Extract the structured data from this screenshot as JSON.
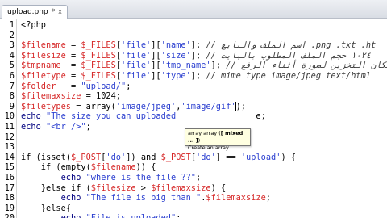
{
  "tab": {
    "title": "upload.php",
    "modified": "*",
    "close": "x"
  },
  "lines": [
    {
      "n": "1",
      "segments": [
        {
          "t": "<?php",
          "c": "plain"
        }
      ]
    },
    {
      "n": "2",
      "segments": []
    },
    {
      "n": "3",
      "segments": [
        {
          "t": "$filename",
          "c": "var"
        },
        {
          "t": " = ",
          "c": "plain"
        },
        {
          "t": "$_FILES",
          "c": "var"
        },
        {
          "t": "[",
          "c": "plain"
        },
        {
          "t": "'file'",
          "c": "str"
        },
        {
          "t": "][",
          "c": "plain"
        },
        {
          "t": "'name'",
          "c": "str"
        },
        {
          "t": "]; ",
          "c": "plain"
        },
        {
          "t": "// اسم الملف والتابع .png .txt .ht",
          "c": "cmt"
        }
      ]
    },
    {
      "n": "4",
      "segments": [
        {
          "t": "$filesize",
          "c": "var"
        },
        {
          "t": " = ",
          "c": "plain"
        },
        {
          "t": "$_FILES",
          "c": "var"
        },
        {
          "t": "[",
          "c": "plain"
        },
        {
          "t": "'file'",
          "c": "str"
        },
        {
          "t": "][",
          "c": "plain"
        },
        {
          "t": "'size'",
          "c": "str"
        },
        {
          "t": "]; ",
          "c": "plain"
        },
        {
          "t": "// ١٠٢٤ حجم الملف المطلوب بالبايت",
          "c": "cmt"
        }
      ]
    },
    {
      "n": "5",
      "segments": [
        {
          "t": "$tmpname",
          "c": "var"
        },
        {
          "t": "  = ",
          "c": "plain"
        },
        {
          "t": "$_FILES",
          "c": "var"
        },
        {
          "t": "[",
          "c": "plain"
        },
        {
          "t": "'file'",
          "c": "str"
        },
        {
          "t": "][",
          "c": "plain"
        },
        {
          "t": "'tmp_name'",
          "c": "str"
        },
        {
          "t": "]; ",
          "c": "plain"
        },
        {
          "t": "// مكان التخزين لصورة أثناء الرفع",
          "c": "cmt"
        }
      ]
    },
    {
      "n": "6",
      "segments": [
        {
          "t": "$filetype",
          "c": "var"
        },
        {
          "t": " = ",
          "c": "plain"
        },
        {
          "t": "$_FILES",
          "c": "var"
        },
        {
          "t": "[",
          "c": "plain"
        },
        {
          "t": "'file'",
          "c": "str"
        },
        {
          "t": "][",
          "c": "plain"
        },
        {
          "t": "'type'",
          "c": "str"
        },
        {
          "t": "]; ",
          "c": "plain"
        },
        {
          "t": "// mime type image/jpeg text/html",
          "c": "cmt"
        }
      ]
    },
    {
      "n": "7",
      "segments": [
        {
          "t": "$folder",
          "c": "var"
        },
        {
          "t": "   = ",
          "c": "plain"
        },
        {
          "t": "\"upload/\"",
          "c": "str"
        },
        {
          "t": ";",
          "c": "plain"
        }
      ]
    },
    {
      "n": "8",
      "segments": [
        {
          "t": "$filemaxsize",
          "c": "var"
        },
        {
          "t": " = 1024;",
          "c": "plain"
        }
      ]
    },
    {
      "n": "9",
      "segments": [
        {
          "t": "$filetypes",
          "c": "var"
        },
        {
          "t": " = array(",
          "c": "plain"
        },
        {
          "t": "'image/jpeg'",
          "c": "str"
        },
        {
          "t": ",",
          "c": "plain"
        },
        {
          "t": "'image/gif'",
          "c": "str"
        },
        {
          "t": ");",
          "c": "plain"
        }
      ]
    },
    {
      "n": "10",
      "segments": [
        {
          "t": "echo ",
          "c": "kw"
        },
        {
          "t": "\"The size you can uploaded ",
          "c": "str"
        },
        {
          "t": "               ",
          "c": "plain"
        },
        {
          "t": "e;",
          "c": "plain"
        }
      ]
    },
    {
      "n": "11",
      "segments": [
        {
          "t": "echo ",
          "c": "kw"
        },
        {
          "t": "\"<br />\"",
          "c": "str"
        },
        {
          "t": ";",
          "c": "plain"
        }
      ]
    },
    {
      "n": "12",
      "segments": []
    },
    {
      "n": "13",
      "segments": []
    },
    {
      "n": "14",
      "segments": [
        {
          "t": "if (isset(",
          "c": "plain"
        },
        {
          "t": "$_POST",
          "c": "var"
        },
        {
          "t": "[",
          "c": "plain"
        },
        {
          "t": "'do'",
          "c": "str"
        },
        {
          "t": "]) and ",
          "c": "plain"
        },
        {
          "t": "$_POST",
          "c": "var"
        },
        {
          "t": "[",
          "c": "plain"
        },
        {
          "t": "'do'",
          "c": "str"
        },
        {
          "t": "] == ",
          "c": "plain"
        },
        {
          "t": "'upload'",
          "c": "str"
        },
        {
          "t": ") {",
          "c": "plain"
        }
      ]
    },
    {
      "n": "15",
      "segments": [
        {
          "t": "    if (empty(",
          "c": "plain"
        },
        {
          "t": "$filename",
          "c": "var"
        },
        {
          "t": ")) {",
          "c": "plain"
        }
      ]
    },
    {
      "n": "16",
      "segments": [
        {
          "t": "        echo ",
          "c": "kw"
        },
        {
          "t": "\"where is the file ??\"",
          "c": "str"
        },
        {
          "t": ";",
          "c": "plain"
        }
      ]
    },
    {
      "n": "17",
      "segments": [
        {
          "t": "    }else if (",
          "c": "plain"
        },
        {
          "t": "$filesize",
          "c": "var"
        },
        {
          "t": " > ",
          "c": "plain"
        },
        {
          "t": "$filemaxsize",
          "c": "var"
        },
        {
          "t": ") {",
          "c": "plain"
        }
      ]
    },
    {
      "n": "18",
      "segments": [
        {
          "t": "        echo ",
          "c": "kw"
        },
        {
          "t": "\"The file is big than \"",
          "c": "str"
        },
        {
          "t": ".",
          "c": "plain"
        },
        {
          "t": "$filemaxsize",
          "c": "var"
        },
        {
          "t": ";",
          "c": "plain"
        }
      ]
    },
    {
      "n": "19",
      "segments": [
        {
          "t": "    }else{",
          "c": "plain"
        }
      ]
    },
    {
      "n": "20",
      "segments": [
        {
          "t": "        echo ",
          "c": "kw"
        },
        {
          "t": "\"File is uploaded\"",
          "c": "str"
        },
        {
          "t": ";",
          "c": "plain"
        }
      ]
    }
  ],
  "tooltip": {
    "signature_pre": "array array (",
    "signature_bold": "[ mixed ... ]",
    "signature_post": ")",
    "description": "Create an array"
  }
}
